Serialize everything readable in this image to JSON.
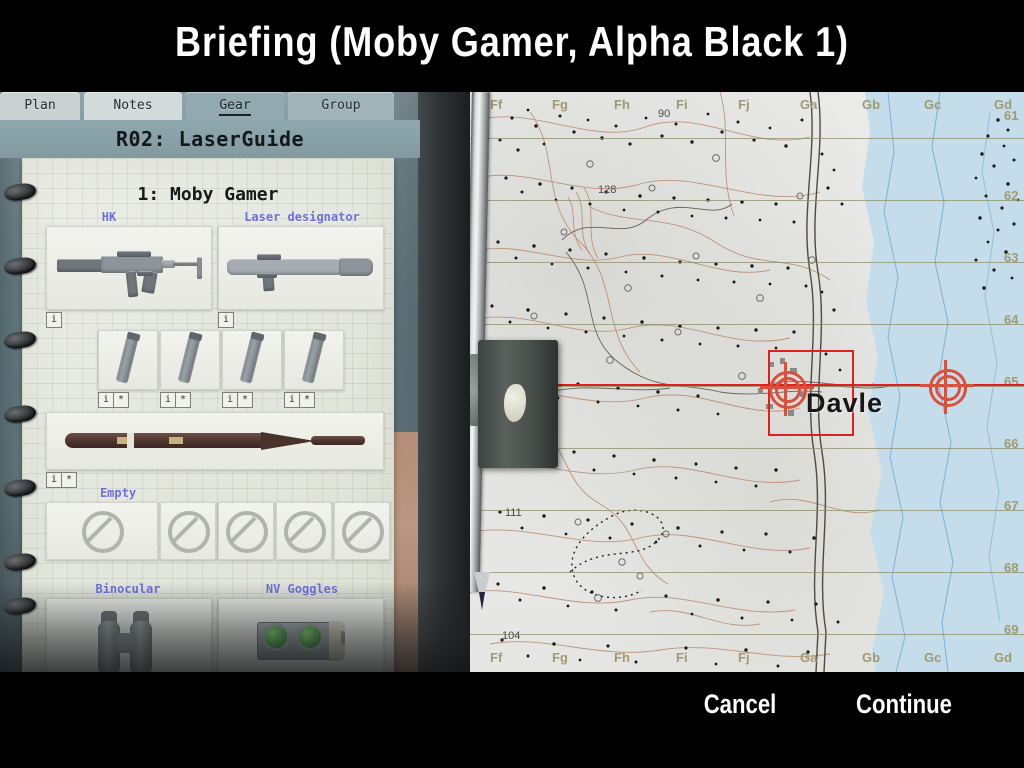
{
  "window": {
    "title": "Briefing (Moby Gamer, Alpha Black 1)"
  },
  "briefing": {
    "tabs": [
      {
        "label": "Plan",
        "active": false
      },
      {
        "label": "Notes",
        "active": false
      },
      {
        "label": "Gear",
        "active": true
      },
      {
        "label": "Group",
        "active": false
      }
    ],
    "page_title": "R02: LaserGuide",
    "soldier": "1: Moby Gamer",
    "primary_slots": [
      {
        "label": "HK",
        "badge": [
          "i"
        ]
      },
      {
        "label": "Laser designator",
        "badge": [
          "i"
        ]
      }
    ],
    "magazine_slots": [
      {
        "badge": [
          "i",
          "*"
        ]
      },
      {
        "badge": [
          "i",
          "*"
        ]
      },
      {
        "badge": [
          "i",
          "*"
        ]
      },
      {
        "badge": [
          "i",
          "*"
        ]
      }
    ],
    "ordnance_slot": {
      "badge": [
        "i",
        "*"
      ]
    },
    "inventory_label": "Empty",
    "inventory_slots": 5,
    "optics_slots": [
      {
        "label": "Binocular"
      },
      {
        "label": "NV Goggles"
      }
    ]
  },
  "map": {
    "column_labels": [
      "Ff",
      "Fg",
      "Fh",
      "Fi",
      "Fj",
      "Ga",
      "Gb",
      "Gc",
      "Gd"
    ],
    "row_labels": [
      "61",
      "62",
      "63",
      "64",
      "65",
      "66",
      "67",
      "68",
      "69"
    ],
    "town_label": "Davle",
    "elevations": [
      "90",
      "128",
      "111",
      "104"
    ],
    "colors": {
      "land": "#ececeb",
      "water": "#c5dcea",
      "grid": "#8e8d6a",
      "contour": "#b08a6e",
      "marker_red": "#e02020",
      "crosshair": "#d9503c"
    }
  },
  "footer": {
    "cancel_label": "Cancel",
    "continue_label": "Continue"
  }
}
